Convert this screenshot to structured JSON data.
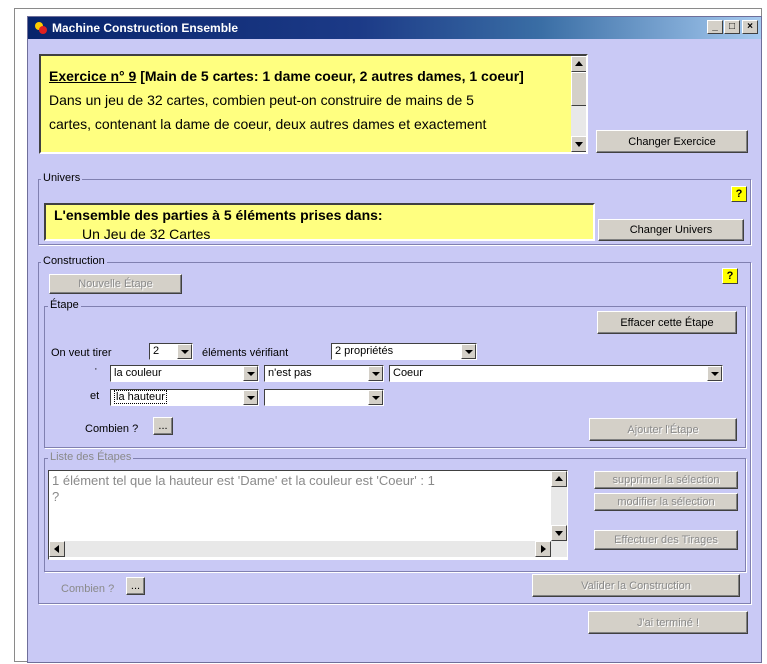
{
  "window": {
    "title": "Machine Construction Ensemble"
  },
  "titlebar_buttons": {
    "minimize": "_",
    "maximize": "□",
    "close": "×"
  },
  "exercise": {
    "number_label": "Exercice n° 9",
    "title": "[Main de 5 cartes: 1 dame coeur, 2 autres dames, 1 coeur]",
    "text_line1": "Dans un jeu de 32 cartes, combien peut-on construire de mains de 5",
    "text_line2": "cartes, contenant la dame de coeur, deux autres dames et exactement",
    "change_button": "Changer Exercice"
  },
  "univers": {
    "group_label": "Univers",
    "help": "?",
    "heading": "L'ensemble des parties à 5 éléments prises dans:",
    "item": "Un Jeu de 32 Cartes",
    "change_button": "Changer Univers"
  },
  "construction": {
    "group_label": "Construction",
    "help": "?",
    "new_step_button": "Nouvelle Étape",
    "etape": {
      "group_label": "Étape",
      "clear_button": "Effacer cette Étape",
      "draw_label": "On veut tirer",
      "draw_count": "2",
      "elements_label": "éléments vérifiant",
      "properties": "2 propriétés",
      "bullet": "·",
      "row1": {
        "attribute": "la couleur",
        "operator": "n'est pas",
        "value": "Coeur"
      },
      "et_label": "et",
      "row2": {
        "attribute": "la hauteur",
        "operator": ""
      },
      "combien_label": "Combien ?",
      "combien_button": "...",
      "add_button": "Ajouter l'Étape"
    },
    "list": {
      "group_label": "Liste des Étapes",
      "line1": "1 élément  tel que  la hauteur est 'Dame' et la couleur est 'Coeur' : 1",
      "line2": "?",
      "delete_button": "supprimer la sélection",
      "modify_button": "modifier la sélection",
      "draw_button": "Effectuer des Tirages"
    },
    "combien_label": "Combien ?",
    "combien_button": "...",
    "validate_button": "Valider la Construction"
  },
  "done_button": "J'ai terminé !"
}
